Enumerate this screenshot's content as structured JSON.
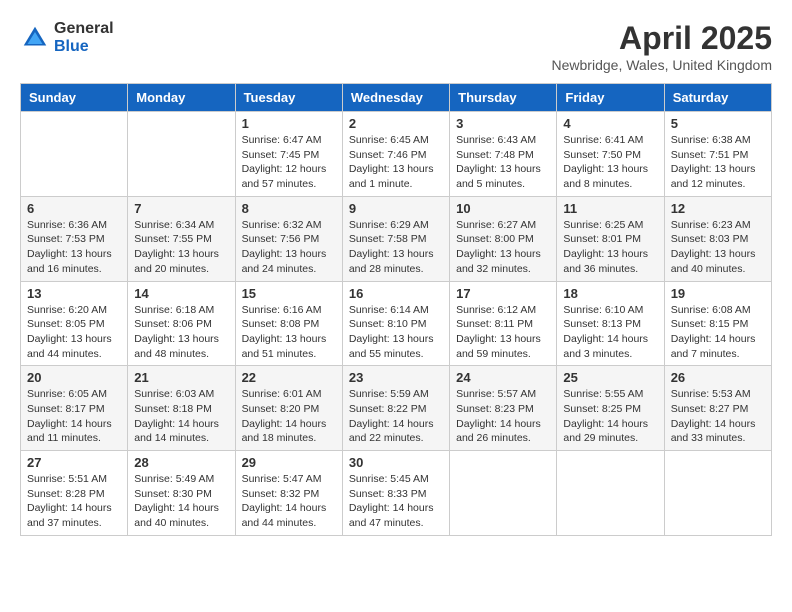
{
  "header": {
    "logo_general": "General",
    "logo_blue": "Blue",
    "month_year": "April 2025",
    "location": "Newbridge, Wales, United Kingdom"
  },
  "days_of_week": [
    "Sunday",
    "Monday",
    "Tuesday",
    "Wednesday",
    "Thursday",
    "Friday",
    "Saturday"
  ],
  "weeks": [
    [
      {
        "day": null
      },
      {
        "day": null
      },
      {
        "day": 1,
        "sunrise": "6:47 AM",
        "sunset": "7:45 PM",
        "daylight": "12 hours and 57 minutes."
      },
      {
        "day": 2,
        "sunrise": "6:45 AM",
        "sunset": "7:46 PM",
        "daylight": "13 hours and 1 minute."
      },
      {
        "day": 3,
        "sunrise": "6:43 AM",
        "sunset": "7:48 PM",
        "daylight": "13 hours and 5 minutes."
      },
      {
        "day": 4,
        "sunrise": "6:41 AM",
        "sunset": "7:50 PM",
        "daylight": "13 hours and 8 minutes."
      },
      {
        "day": 5,
        "sunrise": "6:38 AM",
        "sunset": "7:51 PM",
        "daylight": "13 hours and 12 minutes."
      }
    ],
    [
      {
        "day": 6,
        "sunrise": "6:36 AM",
        "sunset": "7:53 PM",
        "daylight": "13 hours and 16 minutes."
      },
      {
        "day": 7,
        "sunrise": "6:34 AM",
        "sunset": "7:55 PM",
        "daylight": "13 hours and 20 minutes."
      },
      {
        "day": 8,
        "sunrise": "6:32 AM",
        "sunset": "7:56 PM",
        "daylight": "13 hours and 24 minutes."
      },
      {
        "day": 9,
        "sunrise": "6:29 AM",
        "sunset": "7:58 PM",
        "daylight": "13 hours and 28 minutes."
      },
      {
        "day": 10,
        "sunrise": "6:27 AM",
        "sunset": "8:00 PM",
        "daylight": "13 hours and 32 minutes."
      },
      {
        "day": 11,
        "sunrise": "6:25 AM",
        "sunset": "8:01 PM",
        "daylight": "13 hours and 36 minutes."
      },
      {
        "day": 12,
        "sunrise": "6:23 AM",
        "sunset": "8:03 PM",
        "daylight": "13 hours and 40 minutes."
      }
    ],
    [
      {
        "day": 13,
        "sunrise": "6:20 AM",
        "sunset": "8:05 PM",
        "daylight": "13 hours and 44 minutes."
      },
      {
        "day": 14,
        "sunrise": "6:18 AM",
        "sunset": "8:06 PM",
        "daylight": "13 hours and 48 minutes."
      },
      {
        "day": 15,
        "sunrise": "6:16 AM",
        "sunset": "8:08 PM",
        "daylight": "13 hours and 51 minutes."
      },
      {
        "day": 16,
        "sunrise": "6:14 AM",
        "sunset": "8:10 PM",
        "daylight": "13 hours and 55 minutes."
      },
      {
        "day": 17,
        "sunrise": "6:12 AM",
        "sunset": "8:11 PM",
        "daylight": "13 hours and 59 minutes."
      },
      {
        "day": 18,
        "sunrise": "6:10 AM",
        "sunset": "8:13 PM",
        "daylight": "14 hours and 3 minutes."
      },
      {
        "day": 19,
        "sunrise": "6:08 AM",
        "sunset": "8:15 PM",
        "daylight": "14 hours and 7 minutes."
      }
    ],
    [
      {
        "day": 20,
        "sunrise": "6:05 AM",
        "sunset": "8:17 PM",
        "daylight": "14 hours and 11 minutes."
      },
      {
        "day": 21,
        "sunrise": "6:03 AM",
        "sunset": "8:18 PM",
        "daylight": "14 hours and 14 minutes."
      },
      {
        "day": 22,
        "sunrise": "6:01 AM",
        "sunset": "8:20 PM",
        "daylight": "14 hours and 18 minutes."
      },
      {
        "day": 23,
        "sunrise": "5:59 AM",
        "sunset": "8:22 PM",
        "daylight": "14 hours and 22 minutes."
      },
      {
        "day": 24,
        "sunrise": "5:57 AM",
        "sunset": "8:23 PM",
        "daylight": "14 hours and 26 minutes."
      },
      {
        "day": 25,
        "sunrise": "5:55 AM",
        "sunset": "8:25 PM",
        "daylight": "14 hours and 29 minutes."
      },
      {
        "day": 26,
        "sunrise": "5:53 AM",
        "sunset": "8:27 PM",
        "daylight": "14 hours and 33 minutes."
      }
    ],
    [
      {
        "day": 27,
        "sunrise": "5:51 AM",
        "sunset": "8:28 PM",
        "daylight": "14 hours and 37 minutes."
      },
      {
        "day": 28,
        "sunrise": "5:49 AM",
        "sunset": "8:30 PM",
        "daylight": "14 hours and 40 minutes."
      },
      {
        "day": 29,
        "sunrise": "5:47 AM",
        "sunset": "8:32 PM",
        "daylight": "14 hours and 44 minutes."
      },
      {
        "day": 30,
        "sunrise": "5:45 AM",
        "sunset": "8:33 PM",
        "daylight": "14 hours and 47 minutes."
      },
      {
        "day": null
      },
      {
        "day": null
      },
      {
        "day": null
      }
    ]
  ]
}
